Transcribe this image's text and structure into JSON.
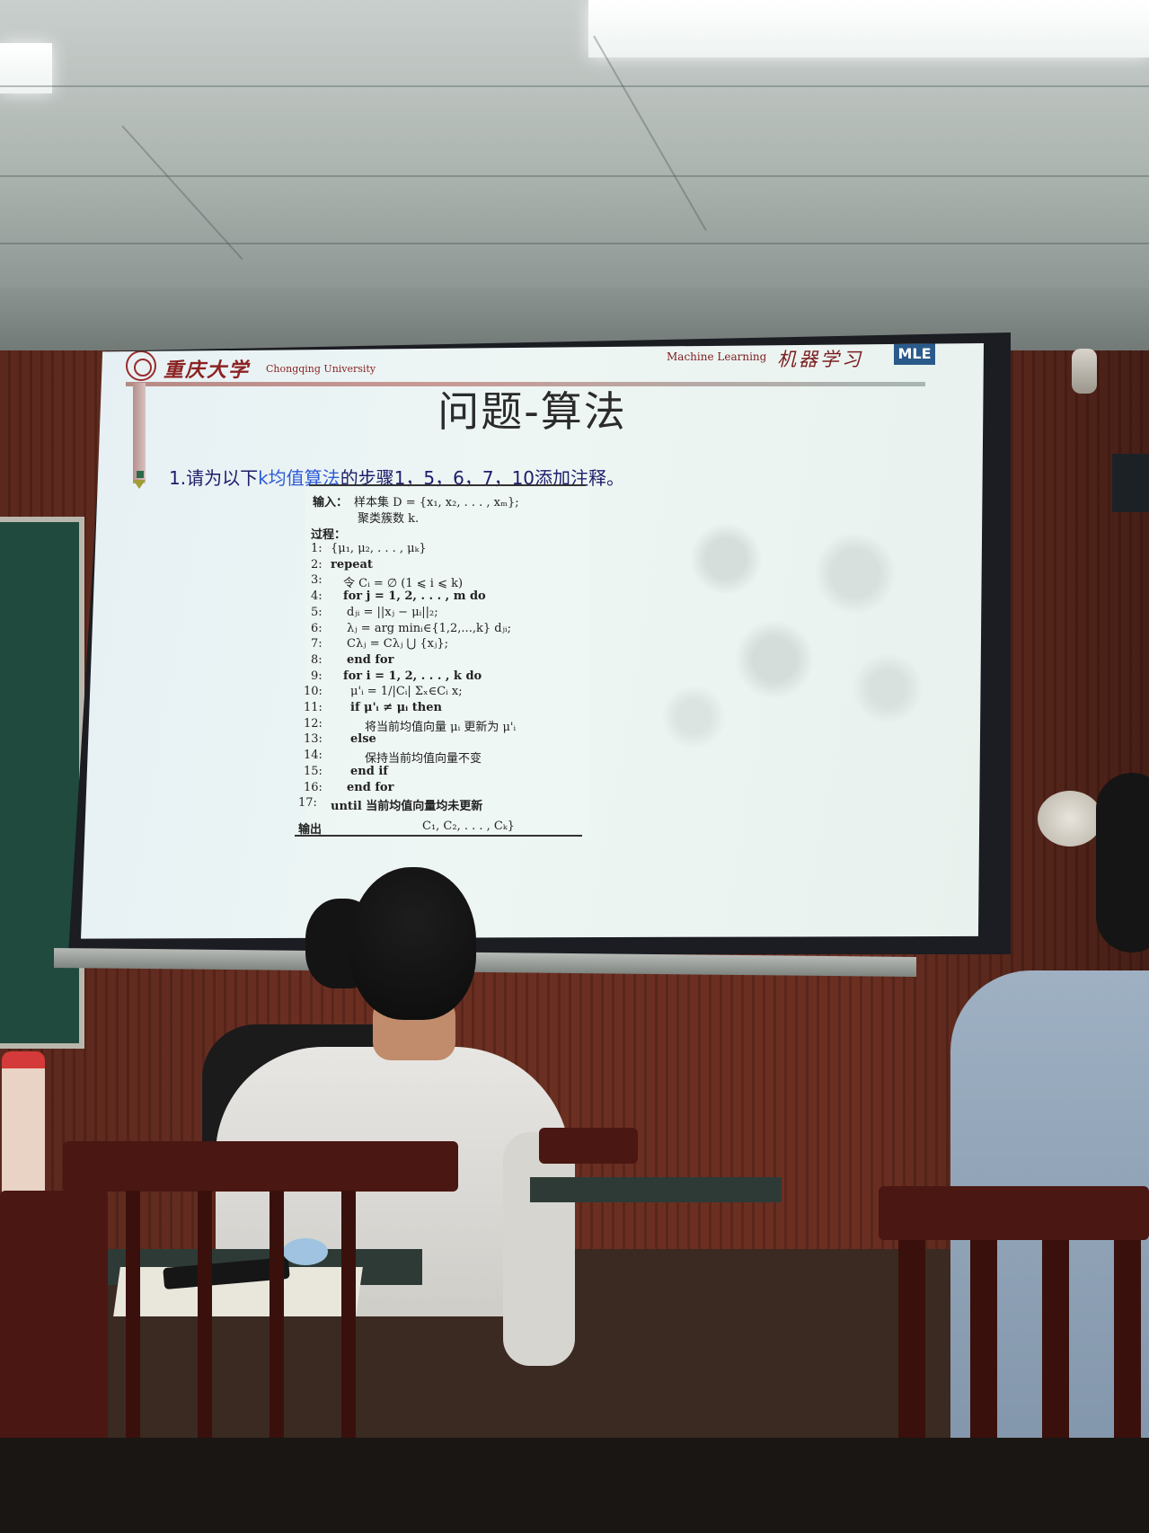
{
  "slide": {
    "university_cn": "重庆大学",
    "university_en": "Chongqing University",
    "course_en": "Machine Learning",
    "course_cn": "机器学习",
    "logo_text": "MLE",
    "title": "问题-算法",
    "question_prefix": "1.请为以下",
    "question_highlight": "k均值算法",
    "question_suffix": "的步骤1，5，6，7，10添加注释。",
    "algorithm": {
      "input_label": "输入：",
      "input_1": "样本集 D = {x₁, x₂, . . . , xₘ};",
      "input_2": "聚类簇数 k.",
      "process_label": "过程：",
      "lines": [
        {
          "num": "1:",
          "text": "{μ₁, μ₂, . . . , μₖ}"
        },
        {
          "num": "2:",
          "text": "repeat"
        },
        {
          "num": "3:",
          "text": "令 Cᵢ = ∅ (1 ⩽ i ⩽ k)"
        },
        {
          "num": "4:",
          "text": "for j = 1, 2, . . . , m do"
        },
        {
          "num": "5:",
          "text": "dⱼᵢ = ||xⱼ − μᵢ||₂;"
        },
        {
          "num": "6:",
          "text": "λⱼ = arg minᵢ∈{1,2,...,k} dⱼᵢ;"
        },
        {
          "num": "7:",
          "text": "Cλⱼ = Cλⱼ ⋃ {xⱼ};"
        },
        {
          "num": "8:",
          "text": "end for"
        },
        {
          "num": "9:",
          "text": "for i = 1, 2, . . . , k do"
        },
        {
          "num": "10:",
          "text": "μ'ᵢ = 1/|Cᵢ| Σₓ∈Cᵢ x;"
        },
        {
          "num": "11:",
          "text": "if μ'ᵢ ≠ μᵢ then"
        },
        {
          "num": "12:",
          "text": "将当前均值向量 μᵢ 更新为 μ'ᵢ"
        },
        {
          "num": "13:",
          "text": "else"
        },
        {
          "num": "14:",
          "text": "保持当前均值向量不变"
        },
        {
          "num": "15:",
          "text": "end if"
        },
        {
          "num": "16:",
          "text": "end for"
        },
        {
          "num": "17:",
          "text": "until 当前均值向量均未更新"
        }
      ],
      "output_label": "输出",
      "output_text": "C₁, C₂, . . . , Cₖ}"
    }
  },
  "colors": {
    "screen": "#eaf3f1",
    "title_text": "#2b2b2b",
    "question_text": "#1d1d6a",
    "highlight": "#2d5ad8",
    "university_red": "#8c2222",
    "wall_wood": "#6b2f22"
  }
}
